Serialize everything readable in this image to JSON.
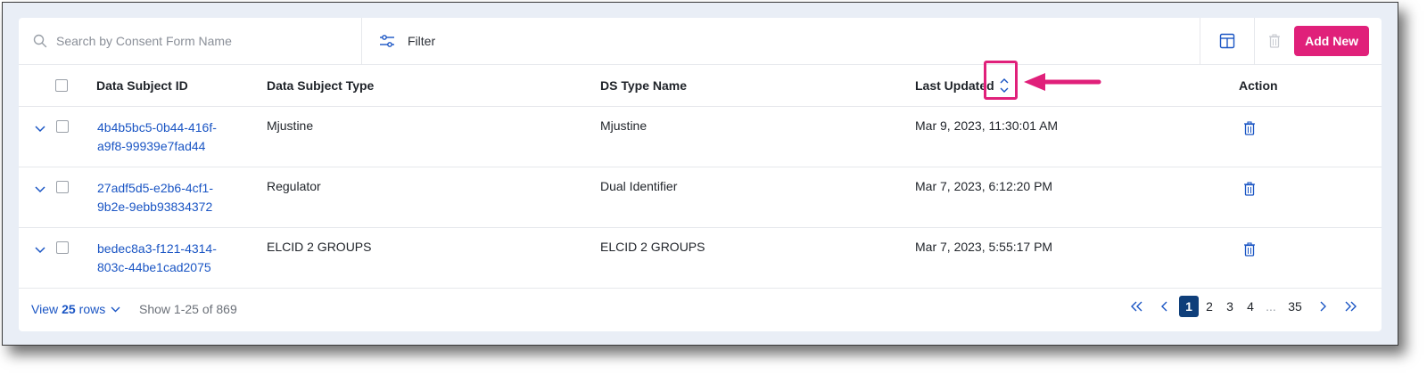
{
  "toolbar": {
    "search_placeholder": "Search by Consent Form Name",
    "filter_label": "Filter",
    "add_new_label": "Add New",
    "accent_color": "#e0207a"
  },
  "table": {
    "columns": {
      "subject_id": "Data Subject ID",
      "subject_type": "Data Subject Type",
      "ds_type_name": "DS Type Name",
      "last_updated": "Last Updated",
      "action": "Action"
    },
    "rows": [
      {
        "id_line1": "4b4b5bc5-0b44-416f-",
        "id_line2": "a9f8-99939e7fad44",
        "type": "Mjustine",
        "ds_type_name": "Mjustine",
        "last_updated": "Mar 9, 2023, 11:30:01 AM"
      },
      {
        "id_line1": "27adf5d5-e2b6-4cf1-",
        "id_line2": "9b2e-9ebb93834372",
        "type": "Regulator",
        "ds_type_name": "Dual Identifier",
        "last_updated": "Mar 7, 2023, 6:12:20 PM"
      },
      {
        "id_line1": "bedec8a3-f121-4314-",
        "id_line2": "803c-44be1cad2075",
        "type": "ELCID 2 GROUPS",
        "ds_type_name": "ELCID 2 GROUPS",
        "last_updated": "Mar 7, 2023, 5:55:17 PM"
      }
    ]
  },
  "footer": {
    "view_prefix": "View",
    "view_count": "25",
    "view_suffix": "rows",
    "show_text": "Show 1-25 of 869",
    "pages": [
      "1",
      "2",
      "3",
      "4",
      "...",
      "35"
    ],
    "current_page": "1"
  },
  "icons": {
    "search": "search-icon",
    "filter": "sliders-icon",
    "columns": "table-columns-icon",
    "delete": "trash-icon",
    "sort": "sort-icon",
    "expand": "chevron-down-icon"
  }
}
